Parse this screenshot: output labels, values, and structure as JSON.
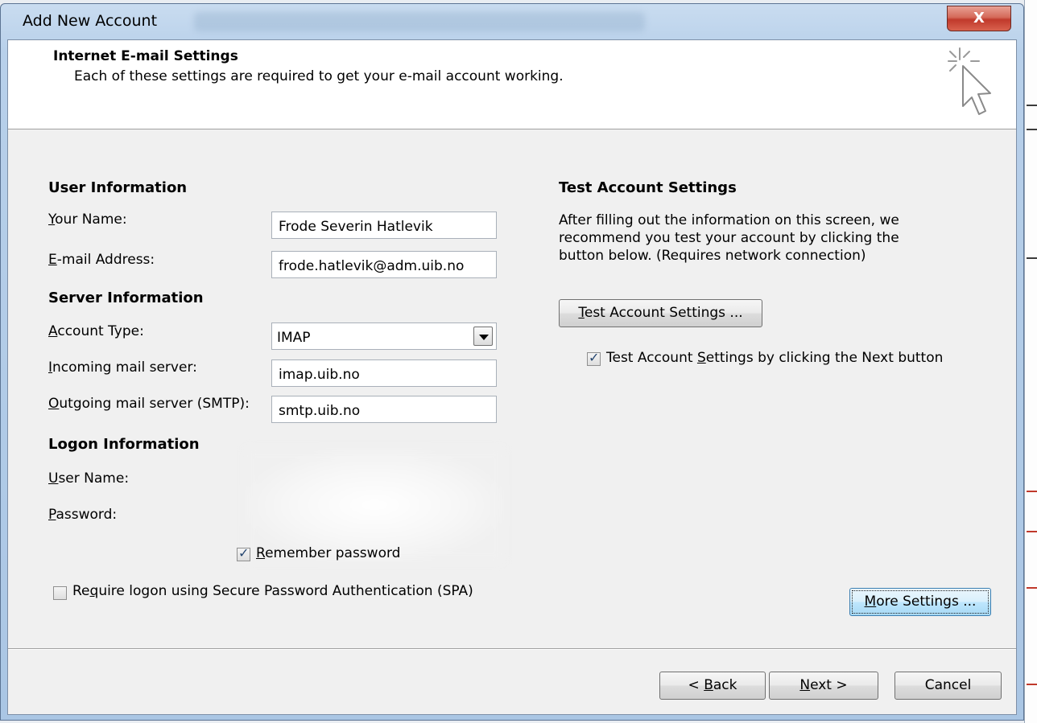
{
  "window": {
    "title": "Add New Account",
    "close_label": "X"
  },
  "header": {
    "title": "Internet E-mail Settings",
    "subtitle": "Each of these settings are required to get your e-mail account working."
  },
  "user_info": {
    "section": "User Information",
    "name_label_access": "Y",
    "name_label_rest": "our Name:",
    "name_value": "Frode Severin Hatlevik",
    "email_label_access": "E",
    "email_label_rest": "-mail Address:",
    "email_value": "frode.hatlevik@adm.uib.no"
  },
  "server_info": {
    "section": "Server Information",
    "account_type_label_access": "A",
    "account_type_label_rest": "ccount Type:",
    "account_type_value": "IMAP",
    "incoming_label_access": "I",
    "incoming_label_rest": "ncoming mail server:",
    "incoming_value": "imap.uib.no",
    "outgoing_label_access": "O",
    "outgoing_label_rest": "utgoing mail server (SMTP):",
    "outgoing_value": "smtp.uib.no"
  },
  "logon_info": {
    "section": "Logon Information",
    "username_label_access": "U",
    "username_label_rest": "ser Name:",
    "password_label_access": "P",
    "password_label_rest": "assword:",
    "remember_access": "R",
    "remember_rest": "emember password",
    "remember_checked": true,
    "spa_pre": "Re",
    "spa_access": "q",
    "spa_rest": "uire logon using Secure Password Authentication (SPA)",
    "spa_checked": false
  },
  "test_settings": {
    "section": "Test Account Settings",
    "description": "After filling out the information on this screen, we recommend you test your account by clicking the button below. (Requires network connection)",
    "button_access": "T",
    "button_rest": "est Account Settings ...",
    "auto_pre": "Test Account ",
    "auto_access": "S",
    "auto_rest": "ettings by clicking the Next button",
    "auto_checked": true
  },
  "more_settings": {
    "access": "M",
    "rest": "ore Settings ..."
  },
  "footer": {
    "back_pre": "< ",
    "back_access": "B",
    "back_rest": "ack",
    "next_access": "N",
    "next_rest": "ext >",
    "cancel": "Cancel"
  }
}
